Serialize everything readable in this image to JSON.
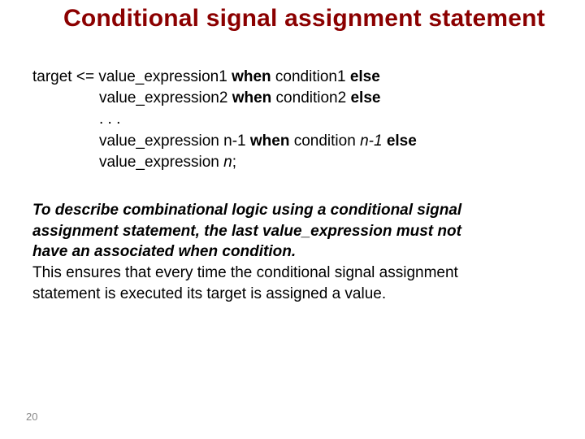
{
  "title": "Conditional signal assignment statement",
  "syntax": {
    "l1_a": "target <= value_expression1 ",
    "l1_w": "when",
    "l1_b": " condition1 ",
    "l1_e": "else",
    "l2_a": "value_expression2 ",
    "l2_w": "when",
    "l2_b": " condition2 ",
    "l2_e": "else",
    "l3": ". . .",
    "l4_a": "value_expression n-1 ",
    "l4_w": "when",
    "l4_b": " condition ",
    "l4_i": "n-1 ",
    "l4_e": "else",
    "l5_a": "value_expression ",
    "l5_i": "n",
    "l5_end": ";"
  },
  "desc": {
    "d1": "To describe combinational logic using a conditional signal",
    "d2": "assignment statement, the last value_expression must not",
    "d3": "have an associated when condition.",
    "d4": "This ensures that every time the conditional signal assignment",
    "d5": "statement is executed its target is assigned a value."
  },
  "page_number": "20"
}
